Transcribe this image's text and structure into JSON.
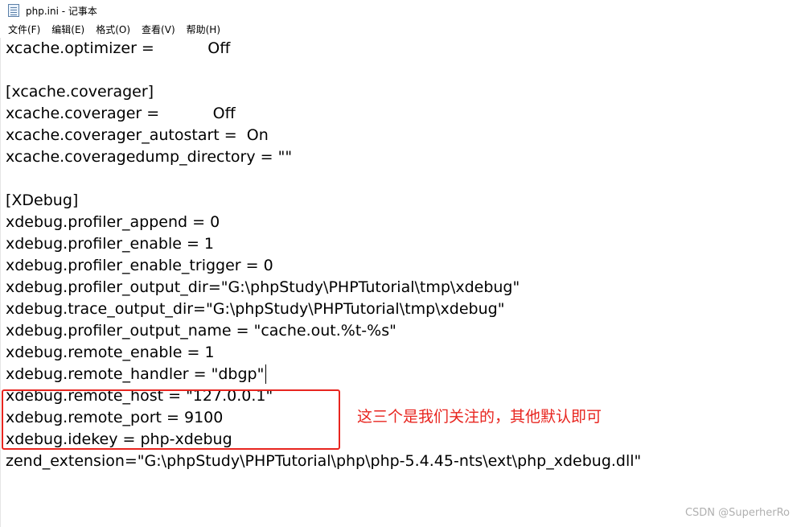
{
  "window": {
    "title": "php.ini - 记事本",
    "icon": "notepad-icon"
  },
  "menu": [
    "文件(F)",
    "编辑(E)",
    "格式(O)",
    "查看(V)",
    "帮助(H)"
  ],
  "editor": {
    "lines": [
      "xcache.optimizer =           Off",
      "",
      "[xcache.coverager]",
      "xcache.coverager =           Off",
      "xcache.coverager_autostart =  On",
      "xcache.coveragedump_directory = \"\"",
      "",
      "[XDebug]",
      "xdebug.profiler_append = 0",
      "xdebug.profiler_enable = 1",
      "xdebug.profiler_enable_trigger = 0",
      "xdebug.profiler_output_dir=\"G:\\phpStudy\\PHPTutorial\\tmp\\xdebug\"",
      "xdebug.trace_output_dir=\"G:\\phpStudy\\PHPTutorial\\tmp\\xdebug\"",
      "xdebug.profiler_output_name = \"cache.out.%t-%s\"",
      "xdebug.remote_enable = 1",
      "xdebug.remote_handler = \"dbgp\"",
      "xdebug.remote_host = \"127.0.0.1\"",
      "xdebug.remote_port = 9100",
      "xdebug.idekey = php-xdebug",
      "zend_extension=\"G:\\phpStudy\\PHPTutorial\\php\\php-5.4.45-nts\\ext\\php_xdebug.dll\""
    ]
  },
  "annotation": {
    "text": "这三个是我们关注的，其他默认即可",
    "color": "#e8251f"
  },
  "watermark": "CSDN @SuperherRo"
}
